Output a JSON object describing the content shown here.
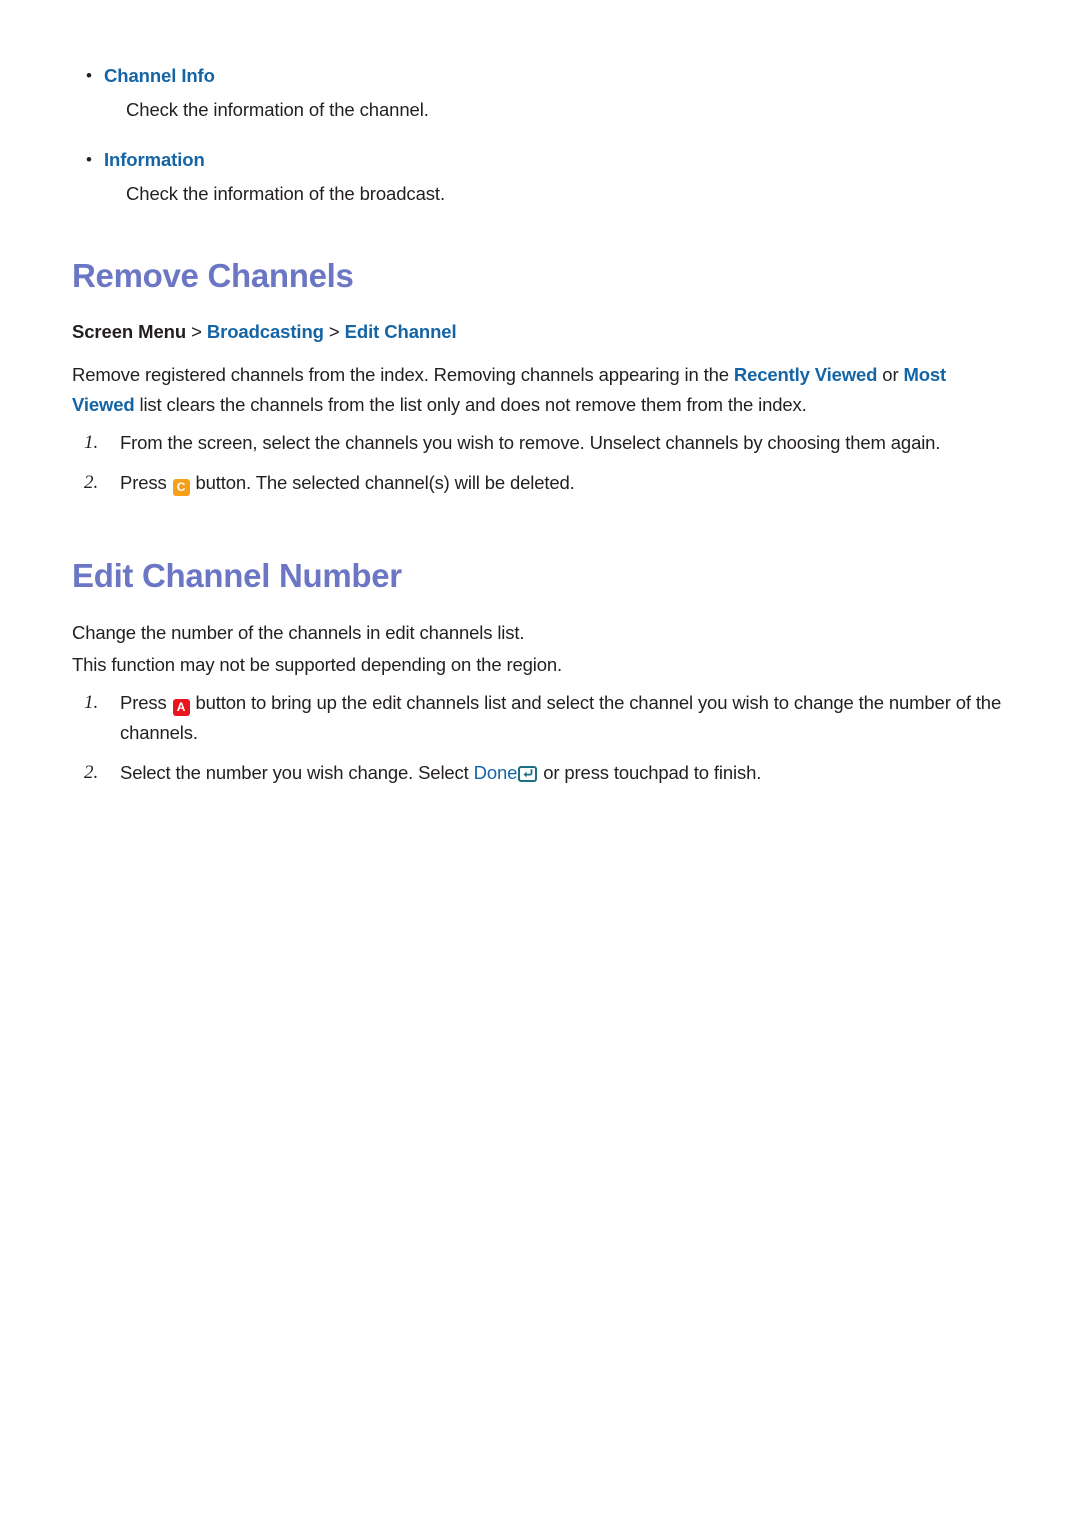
{
  "colors": {
    "heading": "#6b76c4",
    "link": "#1565a6",
    "body": "#231f20",
    "key_c_bg": "#f6a01a",
    "key_a_bg": "#e8151d",
    "enter_key_outline": "#1a6f83"
  },
  "bullets": [
    {
      "title": "Channel Info",
      "description": "Check the information of the channel."
    },
    {
      "title": "Information",
      "description": "Check the information of the broadcast."
    }
  ],
  "remove_channels": {
    "heading": "Remove Channels",
    "breadcrumb": {
      "root": "Screen Menu",
      "sep": " > ",
      "level1": "Broadcasting",
      "level2": "Edit Channel"
    },
    "intro": {
      "part1": "Remove registered channels from the index. Removing channels appearing in the ",
      "highlight1": "Recently Viewed",
      "part2": " or ",
      "highlight2": "Most Viewed",
      "part3": " list clears the channels from the list only and does not remove them from the index."
    },
    "steps": [
      {
        "number": "1.",
        "text": "From the screen, select the channels you wish to remove. Unselect channels by choosing them again."
      },
      {
        "number": "2.",
        "prefix": "Press ",
        "key": "C",
        "key_name": "c-button-icon",
        "suffix": " button. The selected channel(s) will be deleted."
      }
    ]
  },
  "edit_channel_number": {
    "heading": "Edit Channel Number",
    "paragraphs": [
      "Change the number of the channels in edit channels list.",
      "This function may not be supported depending on the region."
    ],
    "steps": [
      {
        "number": "1.",
        "prefix": "Press ",
        "key": "A",
        "key_name": "a-button-icon",
        "suffix": " button to bring up the edit channels list and select the channel you wish to change the number of the channels."
      },
      {
        "number": "2.",
        "prefix": "Select the number you wish change. Select ",
        "link": "Done",
        "enter_icon_name": "enter-key-icon",
        "suffix": " or press touchpad to finish."
      }
    ]
  }
}
